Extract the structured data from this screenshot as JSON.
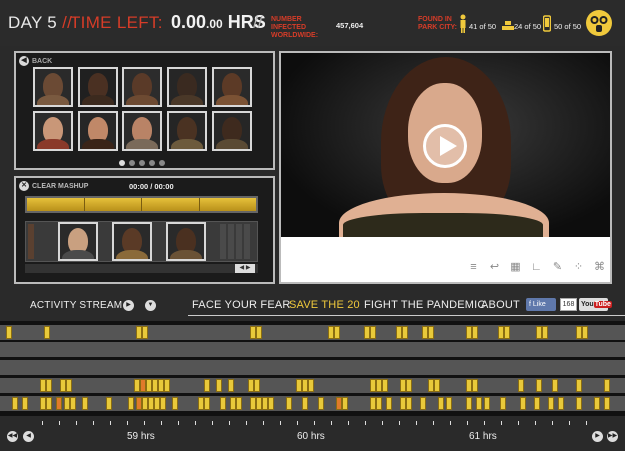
{
  "header": {
    "day_label": "DAY 5",
    "day_slashes": "//",
    "time_left_label": "TIME LEFT:",
    "timer_main": "0.00",
    "timer_small": ".00",
    "timer_unit": "HRS",
    "timer_slashes": "//",
    "infected_label": "NUMBER INFECTED WORLDWIDE:",
    "infected_count": "457,604",
    "found_label": "FOUND IN PARK CITY:",
    "found": [
      {
        "icon": "figure-icon",
        "text": "41 of 50"
      },
      {
        "icon": "gold-bars-icon",
        "text": "24 of 50"
      },
      {
        "icon": "phone-icon",
        "text": "50 of 50"
      }
    ],
    "gasmask_icon": "gas-mask-icon"
  },
  "faces_panel": {
    "back_label": "BACK",
    "page_dots": 5,
    "active_dot": 0
  },
  "mashup_panel": {
    "clear_label": "CLEAR MASHUP",
    "time": "00:00 / 00:00"
  },
  "nav": {
    "activity_label": "ACTIVITY STREAM",
    "links": [
      {
        "label": "FACE YOUR FEAR",
        "active": false
      },
      {
        "label": "SAVE THE 20",
        "active": true
      },
      {
        "label": "FIGHT THE PANDEMIC",
        "active": false
      },
      {
        "label": "ABOUT",
        "active": false
      }
    ],
    "like_label": "Like",
    "like_count": "168",
    "youtube_label_a": "You",
    "youtube_label_b": "Tube"
  },
  "timeline": {
    "hour_labels": [
      "59 hrs",
      "60 hrs",
      "61 hrs"
    ]
  },
  "colors": {
    "accent_red": "#d63c28",
    "accent_yellow": "#f0c93c"
  }
}
